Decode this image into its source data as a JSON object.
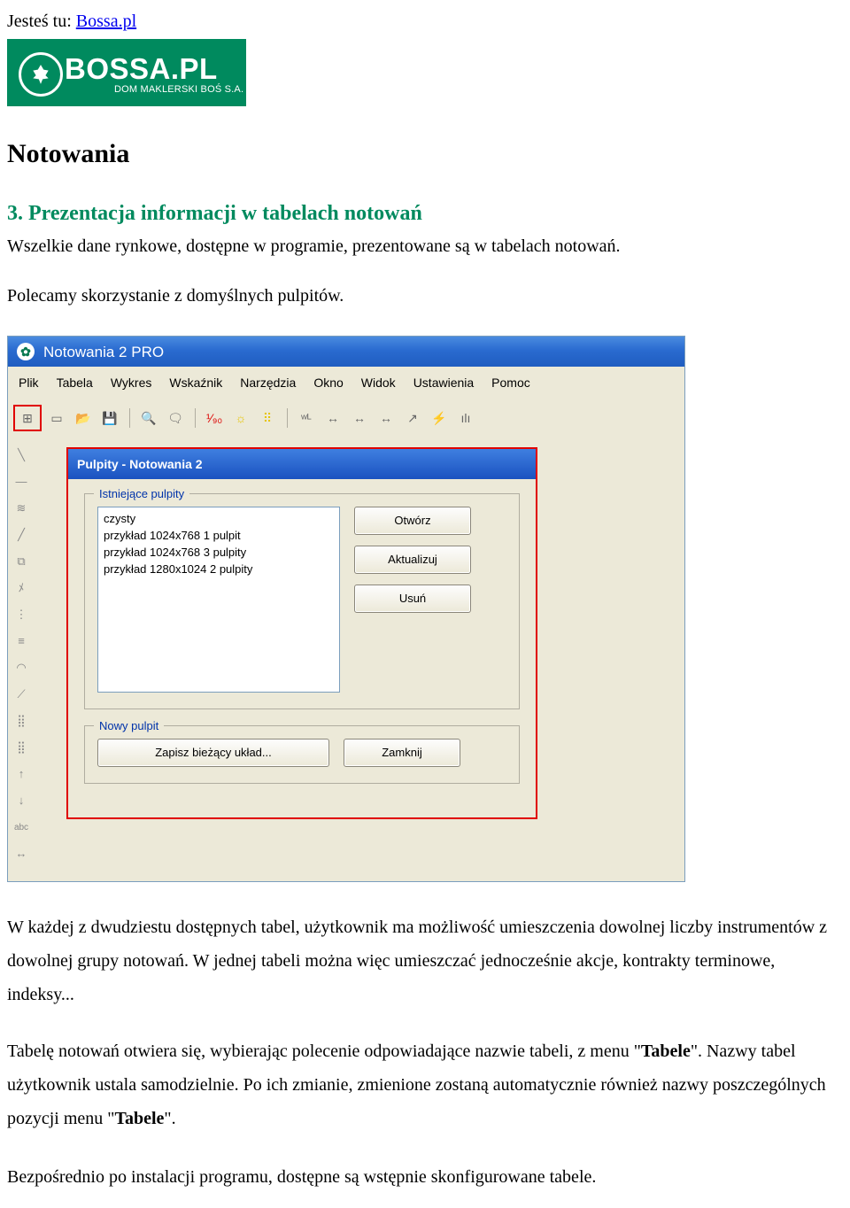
{
  "breadcrumb": {
    "label": "Jesteś tu: ",
    "link": "Bossa.pl"
  },
  "logo": {
    "text": "BOSSA.PL",
    "sub": "DOM MAKLERSKI BOŚ S.A."
  },
  "page_title": "Notowania",
  "sub_title": "3. Prezentacja informacji w tabelach notowań",
  "p_intro": "Wszelkie dane rynkowe, dostępne w programie, prezentowane są w tabelach notowań.",
  "p_rec": "Polecamy skorzystanie z domyślnych pulpitów.",
  "p_after1": "W każdej z dwudziestu dostępnych tabel, użytkownik ma możliwość umieszczenia dowolnej liczby instrumentów z dowolnej grupy notowań. W jednej tabeli można więc umieszczać jednocześnie akcje, kontrakty terminowe, indeksy...",
  "p_after2_a": "Tabelę notowań otwiera się, wybierając polecenie odpowiadające nazwie tabeli, z menu \"",
  "p_after2_b": "\". Nazwy tabel użytkownik ustala samodzielnie. Po ich zmianie, zmienione zostaną automatycznie również nazwy poszczególnych pozycji menu \"",
  "p_after2_c": "\".",
  "bold_tabele": "Tabele",
  "p_after3": "Bezpośrednio po instalacji programu, dostępne są wstępnie skonfigurowane tabele.",
  "app": {
    "title": "Notowania 2 PRO",
    "menu": [
      "Plik",
      "Tabela",
      "Wykres",
      "Wskaźnik",
      "Narzędzia",
      "Okno",
      "Widok",
      "Ustawienia",
      "Pomoc"
    ],
    "toolbar_top": [
      "⊞",
      "▭",
      "📂",
      "💾",
      "|",
      "🔍",
      "🗨",
      "|",
      "¹⁄₉₀",
      "☼",
      "⠿",
      "|",
      "ʷᴸ",
      "↔",
      "↔",
      "↔",
      "↗",
      "⚡",
      "ılı"
    ],
    "toolbar_left": [
      "╲",
      "—",
      "≋",
      "╱",
      "⧉",
      "ﾒ",
      "⋮",
      "≡",
      "◠",
      "⟋",
      "⣿",
      "⣿",
      "↑",
      "↓",
      "abc",
      "↔"
    ],
    "dialog": {
      "title": "Pulpity - Notowania 2",
      "group_existing": "Istniejące pulpity",
      "list": [
        "czysty",
        "przykład 1024x768 1 pulpit",
        "przykład 1024x768 3 pulpity",
        "przykład 1280x1024 2 pulpity"
      ],
      "btn_open": "Otwórz",
      "btn_update": "Aktualizuj",
      "btn_delete": "Usuń",
      "group_new": "Nowy pulpit",
      "btn_save": "Zapisz bieżący układ...",
      "btn_close": "Zamknij"
    }
  }
}
